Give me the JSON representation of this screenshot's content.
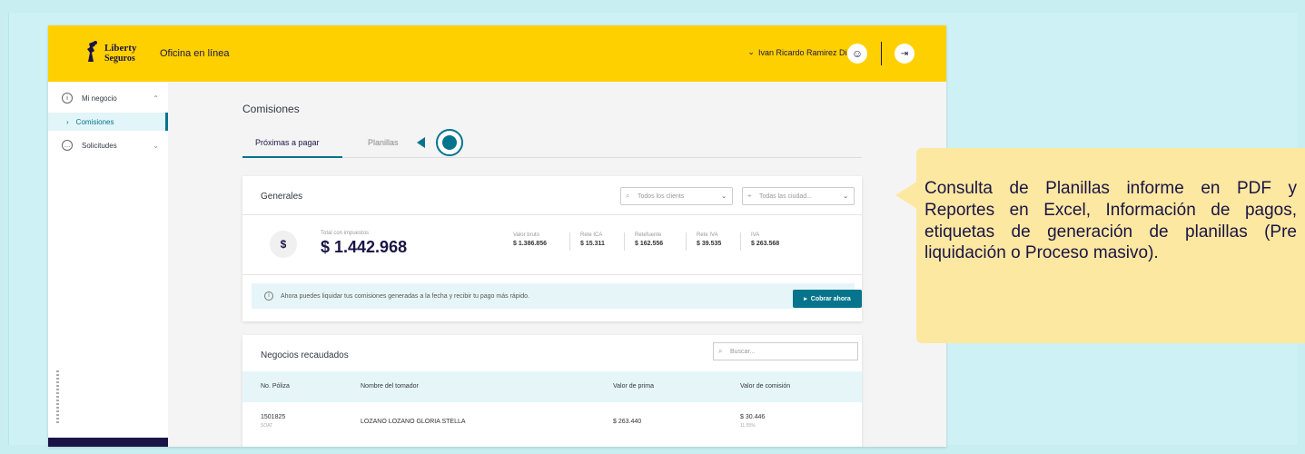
{
  "header": {
    "logo_line1": "Liberty",
    "logo_line2": "Seguros",
    "app_title": "Oficina en línea",
    "user_name": "Ivan Ricardo Ramirez Diaz",
    "brand_color": "#ffd000",
    "navy_color": "#1a1446"
  },
  "sidebar": {
    "items": [
      {
        "label": "Mi negocio",
        "icon": "info-icon"
      },
      {
        "label": "Comisiones",
        "icon": "chevron-right-icon"
      },
      {
        "label": "Solicitudes",
        "icon": "chat-icon"
      }
    ],
    "accent_color": "#06748c"
  },
  "main": {
    "page_title": "Comisiones",
    "tabs": [
      {
        "label": "Próximas a pagar",
        "active": true
      },
      {
        "label": "Planillas",
        "active": false
      }
    ],
    "generales": {
      "title": "Generales",
      "filter_clients": "Todos los clients",
      "filter_cities": "Todas las ciudad...",
      "total_label": "Total con impuestos",
      "total_value": "$ 1.442.968",
      "stats": [
        {
          "label": "Valor bruto",
          "value": "$ 1.386.856"
        },
        {
          "label": "Rete ICA",
          "value": "$ 15.311"
        },
        {
          "label": "Retefuente",
          "value": "$ 162.556"
        },
        {
          "label": "Rete IVA",
          "value": "$ 39.535"
        },
        {
          "label": "IVA",
          "value": "$ 263.568"
        }
      ],
      "info_text": "Ahora puedes liquidar tus comisiones generadas a la fecha y recibir tu pago más rápido.",
      "pay_button": "Cobrar ahora"
    },
    "negocios": {
      "title": "Negocios recaudados",
      "search_placeholder": "Buscar...",
      "columns": [
        "No. Póliza",
        "Nombre del tomador",
        "Valor de prima",
        "Valor de comisión"
      ],
      "rows": [
        {
          "poliza": "1501825",
          "poliza_sub": "SOAT",
          "tomador": "LOZANO LOZANO GLORIA STELLA",
          "prima": "$ 263.440",
          "comision": "$ 30.446",
          "comision_sub": "11.55%"
        }
      ]
    }
  },
  "callout": {
    "text": "Consulta de Planillas informe en PDF y Reportes en Excel, Información de pagos, etiquetas de generación de planillas (Pre liquidación o Proceso masivo).",
    "color": "#fde8a1"
  }
}
